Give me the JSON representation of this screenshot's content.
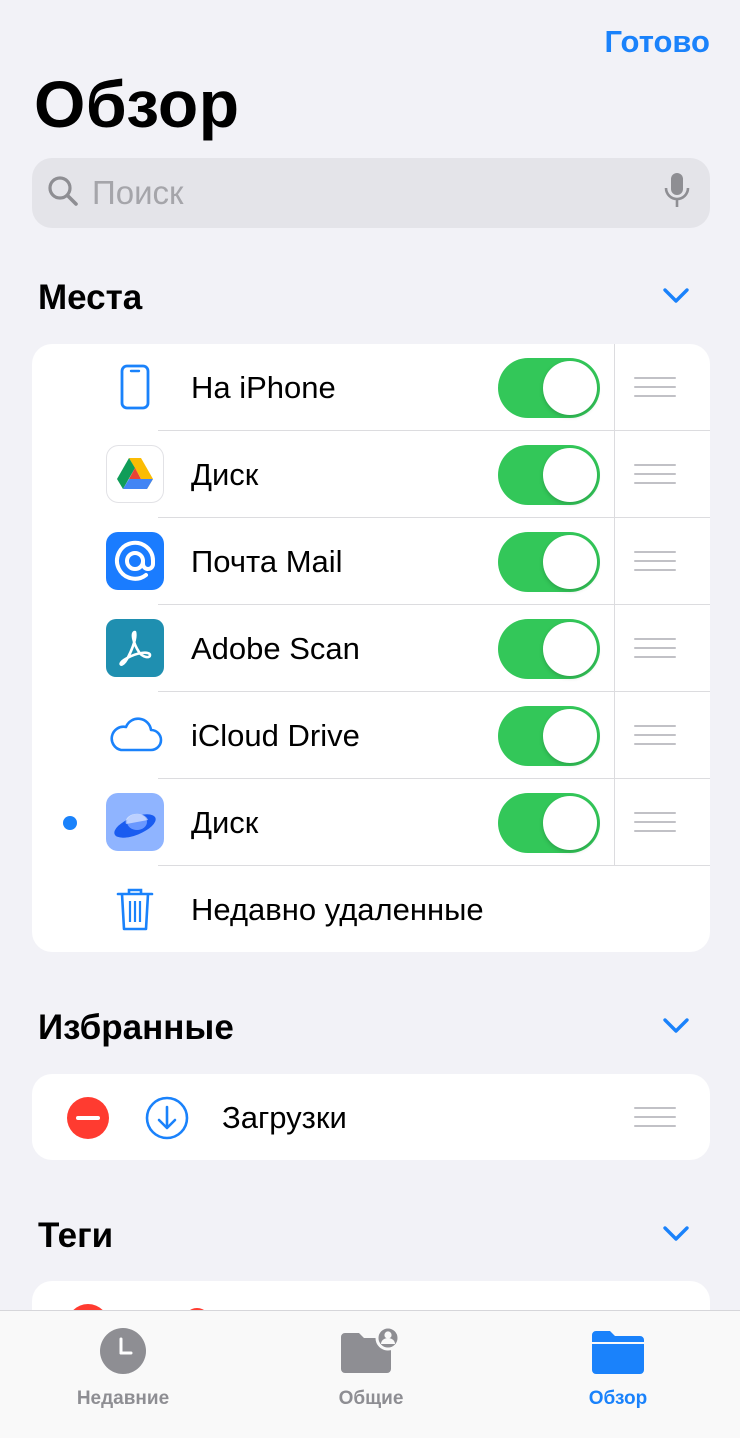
{
  "header": {
    "done_label": "Готово",
    "title": "Обзор"
  },
  "search": {
    "placeholder": "Поиск"
  },
  "sections": {
    "places": {
      "title": "Места",
      "items": [
        {
          "label": "На iPhone",
          "icon": "iphone-icon",
          "toggle": true
        },
        {
          "label": "Диск",
          "icon": "google-drive-icon",
          "toggle": true
        },
        {
          "label": "Почта Mail",
          "icon": "mail-ru-icon",
          "toggle": true
        },
        {
          "label": "Adobe Scan",
          "icon": "adobe-scan-icon",
          "toggle": true
        },
        {
          "label": "iCloud Drive",
          "icon": "icloud-icon",
          "toggle": true
        },
        {
          "label": "Диск",
          "icon": "yandex-disk-icon",
          "toggle": true,
          "current": true
        }
      ],
      "recently_deleted": "Недавно удаленные"
    },
    "favorites": {
      "title": "Избранные",
      "items": [
        {
          "label": "Загрузки",
          "icon": "download-icon"
        }
      ]
    },
    "tags": {
      "title": "Теги"
    }
  },
  "tabbar": {
    "tabs": [
      {
        "label": "Недавние",
        "icon": "clock-icon"
      },
      {
        "label": "Общие",
        "icon": "shared-folder-icon"
      },
      {
        "label": "Обзор",
        "icon": "folder-icon",
        "active": true
      }
    ]
  },
  "colors": {
    "accent": "#1a82fb",
    "toggle_on": "#33c759",
    "delete": "#ff3b30"
  }
}
